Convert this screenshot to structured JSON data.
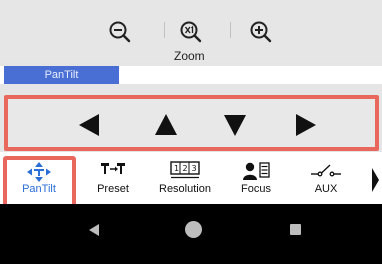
{
  "zoom": {
    "label": "Zoom",
    "buttons": [
      "zoom-out-icon",
      "zoom-reset-icon",
      "zoom-in-icon"
    ]
  },
  "pantilt_tab": {
    "label": "PanTilt"
  },
  "direction_pad": {
    "buttons": [
      "arrow-left-icon",
      "arrow-up-icon",
      "arrow-down-icon",
      "arrow-right-icon"
    ]
  },
  "toolbar": {
    "items": [
      {
        "label": "PanTilt",
        "icon": "pantilt-icon",
        "active": true
      },
      {
        "label": "Preset",
        "icon": "preset-icon",
        "active": false
      },
      {
        "label": "Resolution",
        "icon": "resolution-icon",
        "active": false
      },
      {
        "label": "Focus",
        "icon": "focus-icon",
        "active": false
      },
      {
        "label": "AUX",
        "icon": "aux-switch-icon",
        "active": false
      }
    ],
    "more_icon": "chevron-right-icon"
  },
  "colors": {
    "accent": "#2a6fd8",
    "tab": "#4a6fd4",
    "highlight": "#e8685e"
  },
  "navbar": {
    "icons": [
      "back-icon",
      "home-icon",
      "recents-icon"
    ]
  }
}
